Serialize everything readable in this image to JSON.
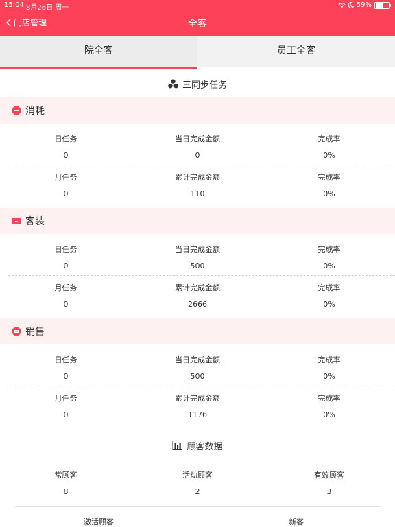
{
  "status_bar": {
    "time": "15:04",
    "date": "8月26日 周一",
    "battery": "59%"
  },
  "nav": {
    "back_label": "门店管理",
    "title": "全客"
  },
  "tabs": [
    {
      "label": "院全客"
    },
    {
      "label": "员工全客"
    }
  ],
  "sync": {
    "label": "三同步任务"
  },
  "sections": [
    {
      "title": "消耗",
      "rows": [
        {
          "c1_label": "日任务",
          "c1_value": "0",
          "c2_label": "当日完成金额",
          "c2_value": "0",
          "c3_label": "完成率",
          "c3_value": "0%"
        },
        {
          "c1_label": "月任务",
          "c1_value": "0",
          "c2_label": "累计完成金额",
          "c2_value": "110",
          "c3_label": "完成率",
          "c3_value": "0%"
        }
      ]
    },
    {
      "title": "客装",
      "rows": [
        {
          "c1_label": "日任务",
          "c1_value": "0",
          "c2_label": "当日完成金额",
          "c2_value": "500",
          "c3_label": "完成率",
          "c3_value": "0%"
        },
        {
          "c1_label": "月任务",
          "c1_value": "0",
          "c2_label": "累计完成金额",
          "c2_value": "2666",
          "c3_label": "完成率",
          "c3_value": "0%"
        }
      ]
    },
    {
      "title": "销售",
      "rows": [
        {
          "c1_label": "日任务",
          "c1_value": "0",
          "c2_label": "当日完成金额",
          "c2_value": "500",
          "c3_label": "完成率",
          "c3_value": "0%"
        },
        {
          "c1_label": "月任务",
          "c1_value": "0",
          "c2_label": "累计完成金额",
          "c2_value": "1176",
          "c3_label": "完成率",
          "c3_value": "0%"
        }
      ]
    }
  ],
  "customer_data": {
    "title": "顾客数据",
    "row1": [
      {
        "label": "常顾客",
        "value": "8"
      },
      {
        "label": "活动顾客",
        "value": "2"
      },
      {
        "label": "有效顾客",
        "value": "3"
      }
    ],
    "row2": [
      {
        "label": "激活顾客"
      },
      {
        "label": "新客"
      }
    ]
  },
  "colors": {
    "accent": "#fd4158",
    "section_bg": "#fdf1f1",
    "tab_bg": "#f2f2f2"
  }
}
